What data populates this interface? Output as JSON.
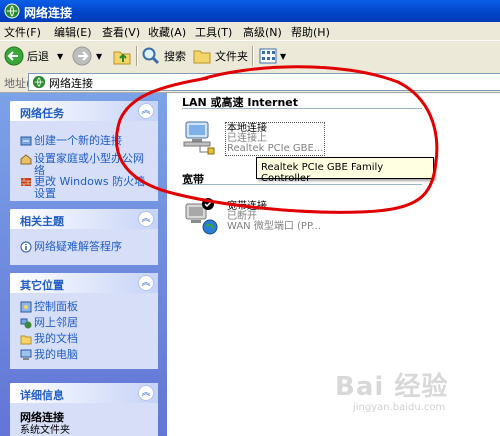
{
  "window": {
    "title": "网络连接"
  },
  "menu": [
    "文件(F)",
    "编辑(E)",
    "查看(V)",
    "收藏(A)",
    "工具(T)",
    "高级(N)",
    "帮助(H)"
  ],
  "toolbar": {
    "back": "后退",
    "search": "搜索",
    "folders": "文件夹"
  },
  "address": {
    "label": "地址(D)",
    "value": "网络连接"
  },
  "sidebar": {
    "network_tasks": {
      "title": "网络任务",
      "items": [
        "创建一个新的连接",
        "设置家庭或小型办公网络",
        "更改 Windows 防火墙设置"
      ]
    },
    "related": {
      "title": "相关主题",
      "items": [
        "网络疑难解答程序"
      ]
    },
    "other_places": {
      "title": "其它位置",
      "items": [
        "控制面板",
        "网上邻居",
        "我的文档",
        "我的电脑"
      ]
    },
    "details": {
      "title": "详细信息",
      "name": "网络连接",
      "type": "系统文件夹"
    }
  },
  "content": {
    "lan_group": "LAN 或高速 Internet",
    "lan_connection": {
      "name": "本地连接",
      "status": "已连接上",
      "device": "Realtek PCIe GBE..."
    },
    "tooltip": "Realtek PCIe GBE Family Controller",
    "broadband_group": "宽带",
    "broadband_connection": {
      "name": "宽带连接",
      "status": "已断开",
      "device": "WAN 微型端口 (PP..."
    }
  },
  "watermark": {
    "text": "Bai 经验",
    "url": "jingyan.baidu.com"
  },
  "colors": {
    "title_bar": "#0a5ee8",
    "sidebar_bg": "#6375d6",
    "panel_bg": "#d6dff7",
    "link": "#215dc6",
    "annotation": "#e00000"
  }
}
